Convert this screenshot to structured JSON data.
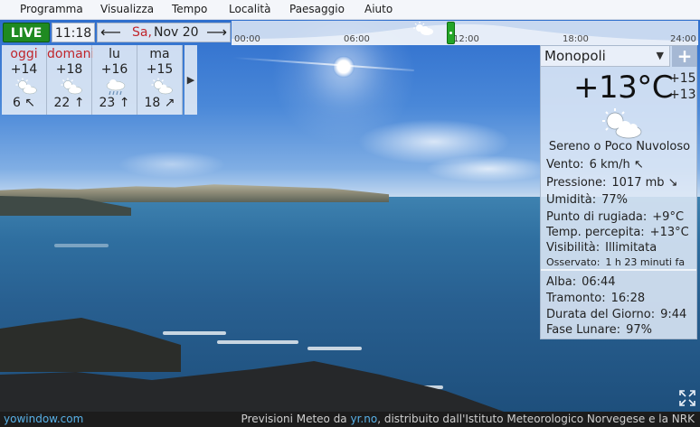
{
  "menu": {
    "items": [
      "Programma",
      "Visualizza",
      "Tempo",
      "Località",
      "Paesaggio",
      "Aiuto"
    ]
  },
  "top_controls": {
    "live_label": "LIVE",
    "time": "11:18",
    "prev_icon": "arrow-left-icon",
    "next_icon": "arrow-right-icon",
    "date_day": "Sa,",
    "date_text": "Nov 20"
  },
  "timeline": {
    "ticks": [
      "00:00",
      "06:00",
      "12:00",
      "18:00",
      "24:00"
    ],
    "current_fraction_of_day": 0.47,
    "weather_icon": "sun-cloud-icon"
  },
  "forecast": {
    "days": [
      {
        "name": "oggi",
        "temp": "+14",
        "icon": "sun-cloud-icon",
        "wind": "6 ↖",
        "name_color": "#c0262c"
      },
      {
        "name": "domani",
        "temp": "+18",
        "icon": "sun-cloud-icon",
        "wind": "22 ↑",
        "name_color": "#c0262c"
      },
      {
        "name": "lu",
        "temp": "+16",
        "icon": "rain-cloud-icon",
        "wind": "23 ↑",
        "name_color": "#222222"
      },
      {
        "name": "ma",
        "temp": "+15",
        "icon": "sun-cloud-icon",
        "wind": "18 ↗",
        "name_color": "#222222"
      }
    ],
    "next_icon": "play-right-icon"
  },
  "current": {
    "location": "Monopoli",
    "temperature": "+13°C",
    "high": "+15",
    "low": "+13",
    "condition": "Sereno o Poco Nuvoloso",
    "details": [
      {
        "label": "Vento:",
        "value": "6 km/h ↖"
      },
      {
        "label": "Pressione:",
        "value": "1017 mb ↘"
      },
      {
        "label": "Umidità:",
        "value": "77%"
      },
      {
        "label": "Punto di rugiada:",
        "value": "+9°C"
      },
      {
        "label": "Temp. percepita:",
        "value": "+13°C"
      },
      {
        "label": "Visibilità:",
        "value": "Illimitata"
      },
      {
        "label": "Osservato:",
        "value": "1 h 23 minuti fa"
      }
    ],
    "astro": [
      {
        "label": "Alba:",
        "value": "06:44"
      },
      {
        "label": "Tramonto:",
        "value": "16:28"
      },
      {
        "label": "Durata del Giorno:",
        "value": "9:44"
      },
      {
        "label": "Fase Lunare:",
        "value": "97%"
      }
    ]
  },
  "footer": {
    "brand": "yowindow.com",
    "credits_prefix": "Previsioni Meteo da",
    "credits_link": "yr.no",
    "credits_suffix": ", distribuito dall'Istituto Meteorologico Norvegese e la NRK"
  },
  "colors": {
    "live_green": "#1f8a21",
    "accent_red": "#c0262c",
    "link_blue": "#58b1e8"
  }
}
